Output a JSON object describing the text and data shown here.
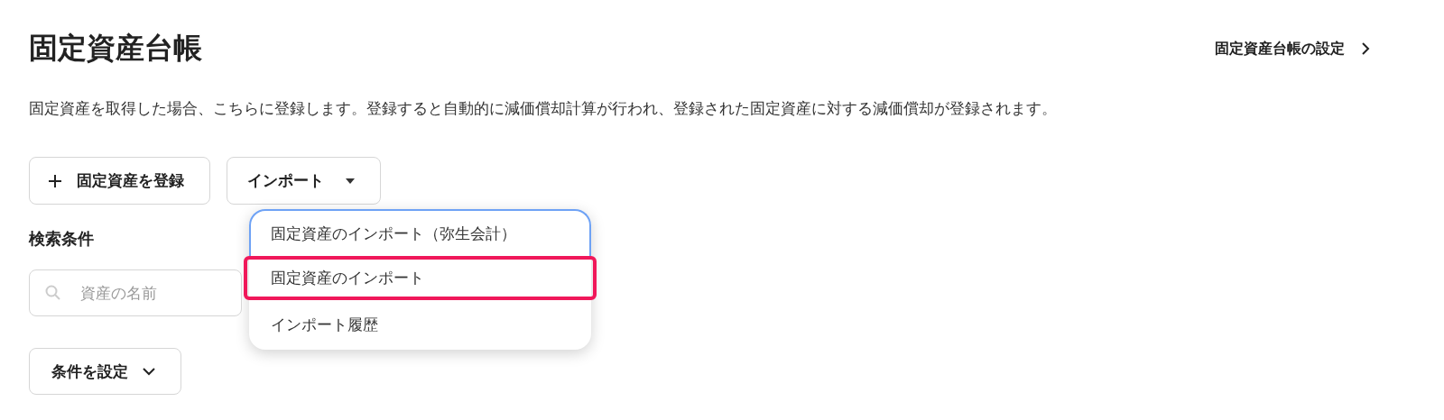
{
  "page": {
    "title": "固定資産台帳",
    "settings_link": "固定資産台帳の設定",
    "description": "固定資産を取得した場合、こちらに登録します。登録すると自動的に減価償却計算が行われ、登録された固定資産に対する減価償却が登録されます。"
  },
  "actions": {
    "register_button": "固定資産を登録",
    "import_button": "インポート"
  },
  "import_menu": {
    "items": [
      {
        "label": "固定資産のインポート（弥生会計）",
        "focused": true,
        "highlighted": false
      },
      {
        "label": "固定資産のインポート",
        "focused": false,
        "highlighted": true
      },
      {
        "label": "インポート履歴",
        "focused": false,
        "highlighted": false
      }
    ]
  },
  "search": {
    "heading": "検索条件",
    "placeholder": "資産の名前",
    "conditions_button": "条件を設定"
  }
}
